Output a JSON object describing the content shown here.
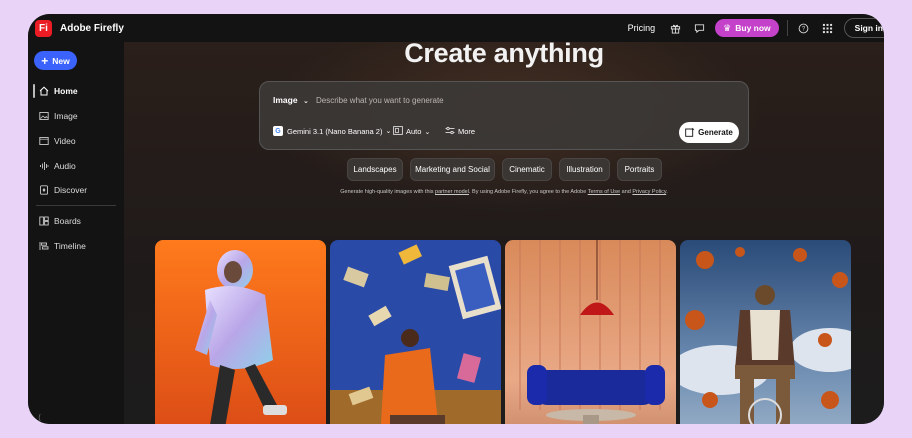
{
  "app": {
    "logo_mark": "Fi",
    "title": "Adobe Firefly"
  },
  "topbar": {
    "pricing": "Pricing",
    "buy_now": "Buy now",
    "sign_in": "Sign in"
  },
  "sidebar": {
    "new_label": "New",
    "items": [
      {
        "label": "Home",
        "icon": "home-icon",
        "active": true
      },
      {
        "label": "Image",
        "icon": "image-icon"
      },
      {
        "label": "Video",
        "icon": "video-icon"
      },
      {
        "label": "Audio",
        "icon": "audio-icon"
      },
      {
        "label": "Discover",
        "icon": "discover-icon"
      },
      {
        "label": "Boards",
        "icon": "boards-icon"
      },
      {
        "label": "Timeline",
        "icon": "timeline-icon"
      }
    ]
  },
  "main": {
    "headline": "Create anything",
    "prompt": {
      "mode": "Image",
      "placeholder": "Describe what you want to generate",
      "value": "",
      "model": "Gemini 3.1 (Nano Banana 2)",
      "aspect": "Auto",
      "more": "More",
      "generate": "Generate"
    },
    "chips": [
      "Landscapes",
      "Marketing and Social",
      "Cinematic",
      "Illustration",
      "Portraits"
    ],
    "disclaimer": {
      "prefix": "Generate high-quality images with this",
      "link1": "partner model",
      "middle": ". By using Adobe Firefly, you agree to the Adobe",
      "link2": "Terms of Use",
      "and": "and",
      "link3": "Privacy Policy",
      "suffix": "."
    }
  },
  "colors": {
    "accent_blue": "#3b63fb",
    "buy_magenta": "#c441c9",
    "brand_red": "#eb1c24",
    "background": "#1b1b1b"
  }
}
